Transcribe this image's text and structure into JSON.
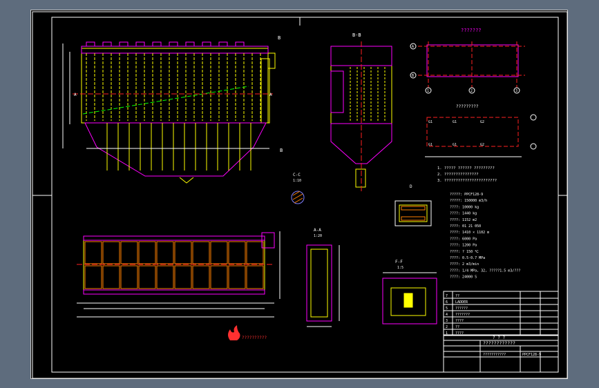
{
  "palette": {
    "sheet_bg": "#000000",
    "frame": "#ffffff",
    "outline": "#ff00ff",
    "structure": "#ffff00",
    "dimension": "#ffffff",
    "centerline": "#ff2020",
    "section_cut": "#00ff00",
    "title_text": "#ffffff",
    "hatch": "#8080ff"
  },
  "views": {
    "front_elevation": {
      "section_mark": "B",
      "labels": [
        "A",
        "A",
        "B"
      ]
    },
    "side_section": {
      "title": "B-B"
    },
    "top_plan": {
      "title": "???????",
      "grid_letters": [
        "A",
        "B"
      ],
      "grid_numbers": [
        "1",
        "2",
        "3"
      ]
    },
    "base_plan": {
      "title": "?????????",
      "load_marks": [
        "G1",
        "G1",
        "G2",
        "G1",
        "G1",
        "G2"
      ]
    },
    "detail_c": {
      "title": "C-C",
      "scale": "1:10"
    },
    "section_aa": {
      "title": "A-A",
      "scale": "1:20"
    },
    "detail_d": {
      "title": "D"
    },
    "section_ff": {
      "title": "F-F",
      "scale": "1:5"
    }
  },
  "notes": [
    "1. ????? ?????? ?????????",
    "2. ???????????????",
    "3. ???????????????????????"
  ],
  "specs": [
    "?????: PPCF128-9",
    "?????: 150000 m3/h",
    "????: 10000 kg",
    "????: 1440 kg",
    "????: 1152 m2",
    "????: 01 21 050",
    "????: 1410 × 1102 m",
    "????: 6000 Pa",
    "????: 1200 Pa",
    "????: ? 150 ℃",
    "????: 0.5-0.7 MPa",
    "????: 2 m3/min",
    "????: 1/4 MPa, 32, ?????1.5 m3/???",
    "????: 24000 S"
  ],
  "parts_list": [
    {
      "no": "7",
      "name": "??"
    },
    {
      "no": "6",
      "name": "LADDER"
    },
    {
      "no": "5",
      "name": "??????"
    },
    {
      "no": "4",
      "name": "???????"
    },
    {
      "no": "3",
      "name": "????"
    },
    {
      "no": "2",
      "name": "??"
    },
    {
      "no": "1",
      "name": "????"
    }
  ],
  "title_block": {
    "header": "? ? ?",
    "company": "????????????",
    "drawing_name": "???????????",
    "drawing_no": "PPCF128-9"
  },
  "logo_text": "??????????"
}
